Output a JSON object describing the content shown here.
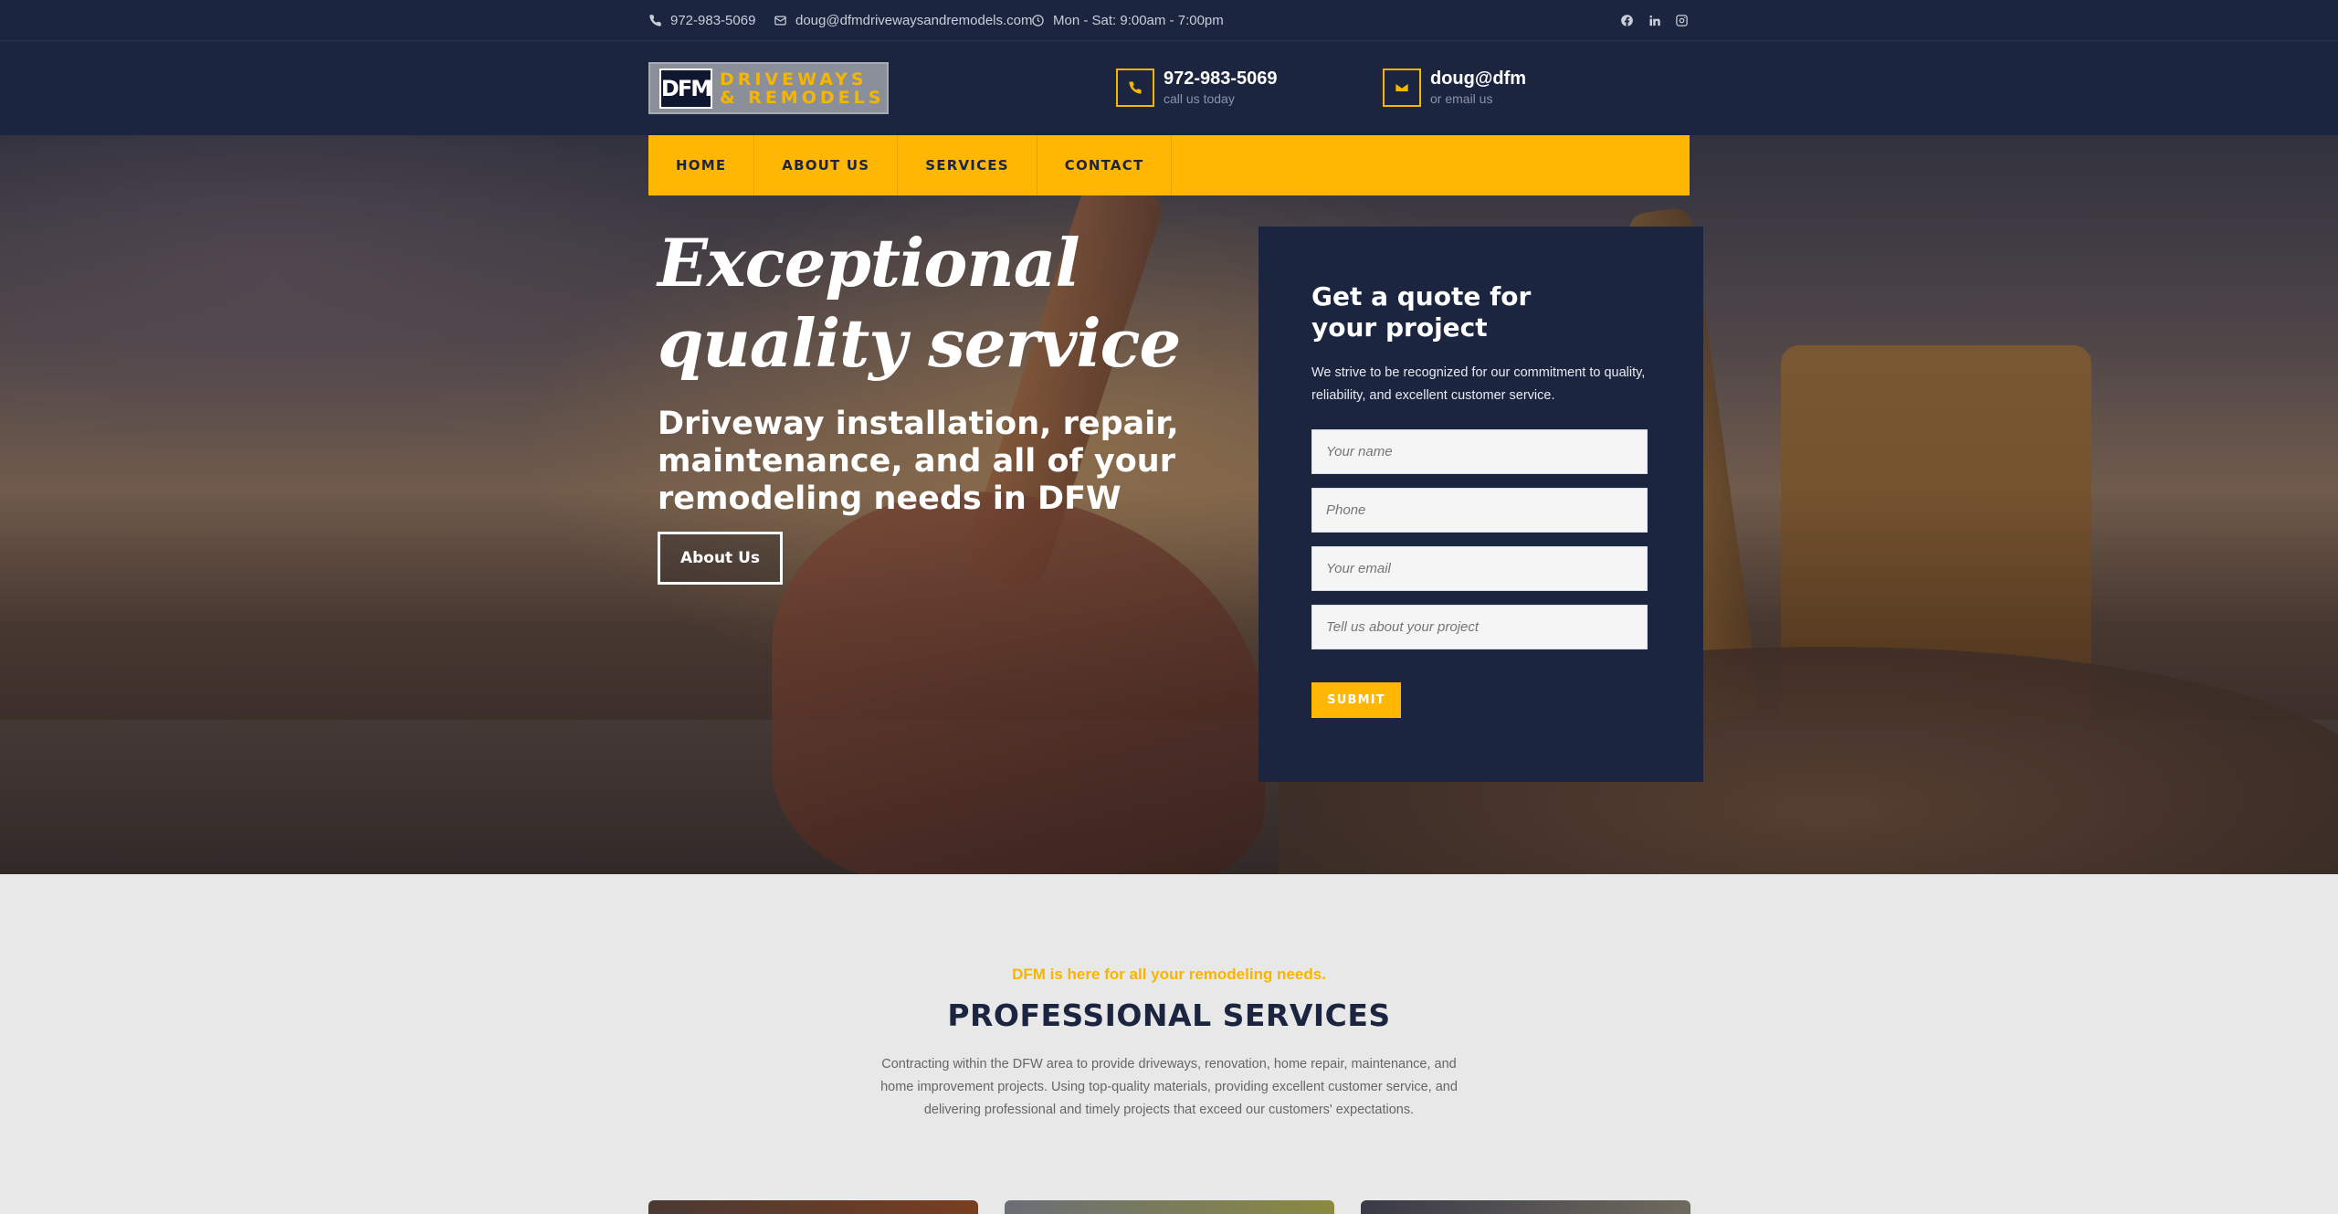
{
  "topbar": {
    "phone": "972-983-5069",
    "email": "doug@dfmdrivewaysandremodels.com",
    "hours": "Mon - Sat: 9:00am - 7:00pm",
    "social": [
      "facebook-icon",
      "linkedin-icon",
      "instagram-icon"
    ]
  },
  "header": {
    "logo_mark": "DFM",
    "logo_line1": "DRIVEWAYS",
    "logo_line2": "& REMODELS",
    "phone_big": "972-983-5069",
    "phone_small": "call us today",
    "email_big": "doug@dfm",
    "email_small": "or email us"
  },
  "nav": {
    "items": [
      "HOME",
      "ABOUT US",
      "SERVICES",
      "CONTACT"
    ]
  },
  "hero": {
    "title_line1": "Exceptional",
    "title_line2": "quality service",
    "subtitle": "Driveway installation, repair, maintenance, and all of your remodeling needs in DFW",
    "button": "About Us"
  },
  "quote": {
    "title": "Get a quote for your project",
    "description": "We strive to be recognized for our commitment to quality, reliability, and excellent customer service.",
    "name_placeholder": "Your name",
    "phone_placeholder": "Phone",
    "email_placeholder": "Your email",
    "project_placeholder": "Tell us about your project",
    "submit": "SUBMIT"
  },
  "services": {
    "kicker": "DFM is here for all your remodeling needs.",
    "title": "PROFESSIONAL SERVICES",
    "description": "Contracting within the DFW area to provide driveways, renovation, home repair, maintenance, and home improvement projects. Using top-quality materials, providing excellent customer service, and delivering professional and timely projects that exceed our customers' expectations."
  },
  "colors": {
    "navy": "#1b2540",
    "accent": "#ffb703"
  }
}
